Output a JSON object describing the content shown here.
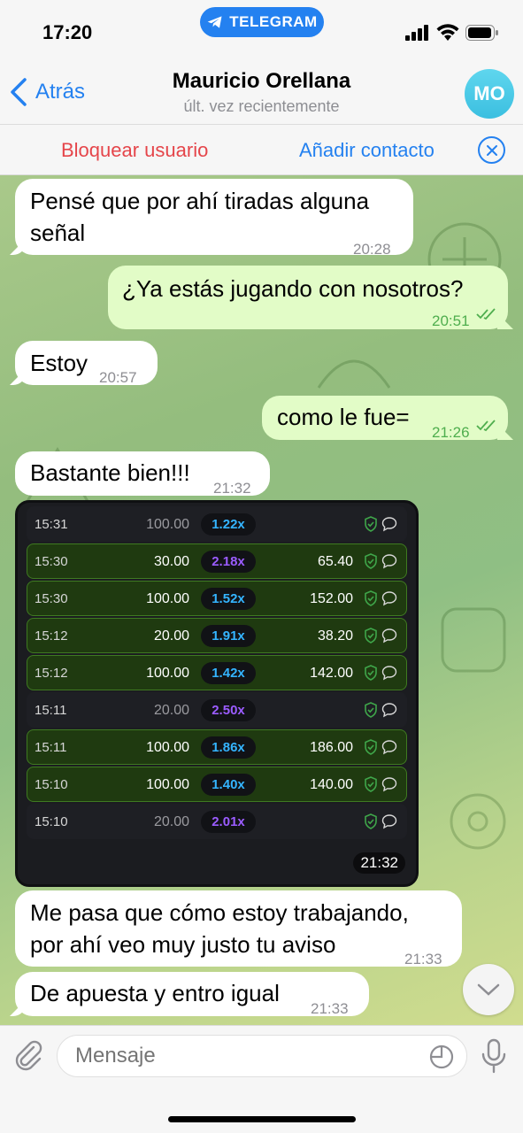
{
  "status": {
    "time": "17:20",
    "app_pill": "TELEGRAM"
  },
  "nav": {
    "back_label": "Atrás",
    "name": "Mauricio Orellana",
    "last_seen": "últ. vez recientemente",
    "avatar_initials": "MO"
  },
  "actions": {
    "block_label": "Bloquear usuario",
    "add_label": "Añadir contacto"
  },
  "messages": {
    "m1": {
      "text_line1": "Pensé que por ahí tiradas alguna",
      "text_line2": "señal",
      "time": "20:28"
    },
    "m2": {
      "text": "¿Ya estás jugando con nosotros?",
      "time": "20:51"
    },
    "m3": {
      "text": "Estoy",
      "time": "20:57"
    },
    "m4": {
      "text": "como le fue=",
      "time": "21:26"
    },
    "m5": {
      "text": "Bastante bien!!!",
      "time": "21:32"
    },
    "img_time": "21:32",
    "m6": {
      "text_line1": "Me pasa que cómo estoy trabajando,",
      "text_line2": "por ahí veo muy justo tu aviso",
      "time": "21:33"
    },
    "m7": {
      "text": "De apuesta y entro igual",
      "time": "21:33"
    }
  },
  "bets": [
    {
      "time": "15:31",
      "bet": "100.00",
      "mult": "1.22x",
      "win": "",
      "status": "lose",
      "mult_color": "#34b4ff"
    },
    {
      "time": "15:30",
      "bet": "30.00",
      "mult": "2.18x",
      "win": "65.40",
      "status": "win",
      "mult_color": "#9b5cff"
    },
    {
      "time": "15:30",
      "bet": "100.00",
      "mult": "1.52x",
      "win": "152.00",
      "status": "win",
      "mult_color": "#34b4ff"
    },
    {
      "time": "15:12",
      "bet": "20.00",
      "mult": "1.91x",
      "win": "38.20",
      "status": "win",
      "mult_color": "#34b4ff"
    },
    {
      "time": "15:12",
      "bet": "100.00",
      "mult": "1.42x",
      "win": "142.00",
      "status": "win",
      "mult_color": "#34b4ff"
    },
    {
      "time": "15:11",
      "bet": "20.00",
      "mult": "2.50x",
      "win": "",
      "status": "lose",
      "mult_color": "#9b5cff"
    },
    {
      "time": "15:11",
      "bet": "100.00",
      "mult": "1.86x",
      "win": "186.00",
      "status": "win",
      "mult_color": "#34b4ff"
    },
    {
      "time": "15:10",
      "bet": "100.00",
      "mult": "1.40x",
      "win": "140.00",
      "status": "win",
      "mult_color": "#34b4ff"
    },
    {
      "time": "15:10",
      "bet": "20.00",
      "mult": "2.01x",
      "win": "",
      "status": "lose",
      "mult_color": "#9b5cff"
    }
  ],
  "input": {
    "placeholder": "Mensaje"
  },
  "colors": {
    "accent": "#2481f0",
    "danger": "#e5454a",
    "out_bubble": "#e2fcc7",
    "read_check": "#4fae4e"
  }
}
